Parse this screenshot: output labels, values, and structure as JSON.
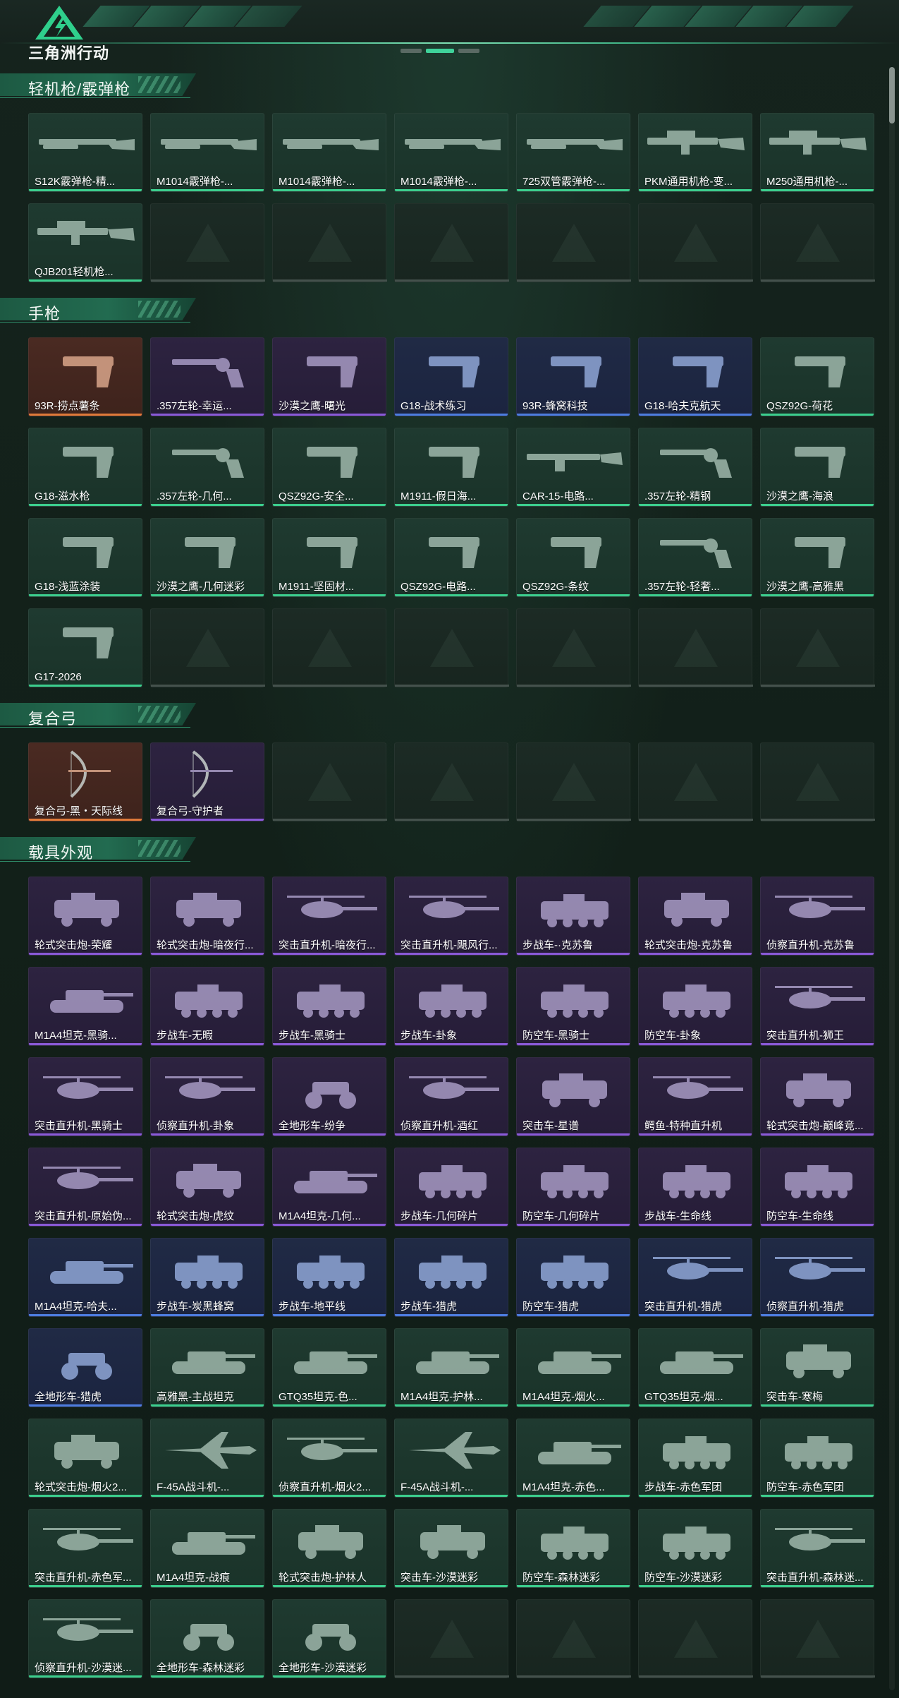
{
  "app": {
    "logo_text": "三角洲行动"
  },
  "colors": {
    "green": "#3ccf8e",
    "blue": "#4d7de0",
    "purple": "#8a5ad8",
    "orange": "#e07a3a",
    "background": "#13201b"
  },
  "sections": [
    {
      "title": "轻机枪/霰弹枪",
      "empty_slots": 6,
      "items": [
        {
          "name": "S12K霰弹枪-精...",
          "rarity": "green",
          "icon": "shotgun-icon"
        },
        {
          "name": "M1014霰弹枪-...",
          "rarity": "green",
          "icon": "shotgun-icon"
        },
        {
          "name": "M1014霰弹枪-...",
          "rarity": "green",
          "icon": "shotgun-icon"
        },
        {
          "name": "M1014霰弹枪-...",
          "rarity": "green",
          "icon": "shotgun-icon"
        },
        {
          "name": "725双管霰弹枪-...",
          "rarity": "green",
          "icon": "shotgun-icon"
        },
        {
          "name": "PKM通用机枪-变...",
          "rarity": "green",
          "icon": "machine-gun-icon"
        },
        {
          "name": "M250通用机枪-...",
          "rarity": "green",
          "icon": "machine-gun-icon"
        },
        {
          "name": "QJB201轻机枪...",
          "rarity": "green",
          "icon": "machine-gun-icon"
        }
      ]
    },
    {
      "title": "手枪",
      "empty_slots": 6,
      "items": [
        {
          "name": "93R-捞点薯条",
          "rarity": "orange",
          "icon": "pistol-icon"
        },
        {
          "name": ".357左轮-幸运...",
          "rarity": "purple",
          "icon": "revolver-icon"
        },
        {
          "name": "沙漠之鹰-曙光",
          "rarity": "purple",
          "icon": "pistol-icon"
        },
        {
          "name": "G18-战术练习",
          "rarity": "blue",
          "icon": "pistol-icon"
        },
        {
          "name": "93R-蜂窝科技",
          "rarity": "blue",
          "icon": "pistol-icon"
        },
        {
          "name": "G18-哈夫克航天",
          "rarity": "blue",
          "icon": "pistol-icon"
        },
        {
          "name": "QSZ92G-荷花",
          "rarity": "green",
          "icon": "pistol-icon"
        },
        {
          "name": "G18-滋水枪",
          "rarity": "green",
          "icon": "pistol-icon"
        },
        {
          "name": ".357左轮-几何...",
          "rarity": "green",
          "icon": "revolver-icon"
        },
        {
          "name": "QSZ92G-安全...",
          "rarity": "green",
          "icon": "pistol-icon"
        },
        {
          "name": "M1911-假日海...",
          "rarity": "green",
          "icon": "pistol-icon"
        },
        {
          "name": "CAR-15-电路...",
          "rarity": "green",
          "icon": "rifle-icon"
        },
        {
          "name": ".357左轮-精钢",
          "rarity": "green",
          "icon": "revolver-icon"
        },
        {
          "name": "沙漠之鹰-海浪",
          "rarity": "green",
          "icon": "pistol-icon"
        },
        {
          "name": "G18-浅蓝涂装",
          "rarity": "green",
          "icon": "pistol-icon"
        },
        {
          "name": "沙漠之鹰-几何迷彩",
          "rarity": "green",
          "icon": "pistol-icon"
        },
        {
          "name": "M1911-坚固材...",
          "rarity": "green",
          "icon": "pistol-icon"
        },
        {
          "name": "QSZ92G-电路...",
          "rarity": "green",
          "icon": "pistol-icon"
        },
        {
          "name": "QSZ92G-条纹",
          "rarity": "green",
          "icon": "pistol-icon"
        },
        {
          "name": ".357左轮-轻奢...",
          "rarity": "green",
          "icon": "revolver-icon"
        },
        {
          "name": "沙漠之鹰-高雅黑",
          "rarity": "green",
          "icon": "pistol-icon"
        },
        {
          "name": "G17-2026",
          "rarity": "green",
          "icon": "pistol-icon"
        }
      ]
    },
    {
      "title": "复合弓",
      "empty_slots": 5,
      "items": [
        {
          "name": "复合弓-黑・天际线",
          "rarity": "orange",
          "icon": "bow-icon"
        },
        {
          "name": "复合弓-守护者",
          "rarity": "purple",
          "icon": "bow-icon"
        }
      ]
    },
    {
      "title": "载具外观",
      "empty_slots": 4,
      "items": [
        {
          "name": "轮式突击炮-荣耀",
          "rarity": "purple",
          "icon": "armored-car-icon"
        },
        {
          "name": "轮式突击炮-暗夜行...",
          "rarity": "purple",
          "icon": "armored-car-icon"
        },
        {
          "name": "突击直升机-暗夜行...",
          "rarity": "purple",
          "icon": "helicopter-icon"
        },
        {
          "name": "突击直升机-飓风行...",
          "rarity": "purple",
          "icon": "helicopter-icon"
        },
        {
          "name": "步战车-·克苏鲁",
          "rarity": "purple",
          "icon": "ifv-icon"
        },
        {
          "name": "轮式突击炮-克苏鲁",
          "rarity": "purple",
          "icon": "armored-car-icon"
        },
        {
          "name": "侦察直升机-克苏鲁",
          "rarity": "purple",
          "icon": "helicopter-icon"
        },
        {
          "name": "M1A4坦克-黑骑...",
          "rarity": "purple",
          "icon": "tank-icon"
        },
        {
          "name": "步战车-无暇",
          "rarity": "purple",
          "icon": "ifv-icon"
        },
        {
          "name": "步战车-黑骑士",
          "rarity": "purple",
          "icon": "ifv-icon"
        },
        {
          "name": "步战车-卦象",
          "rarity": "purple",
          "icon": "ifv-icon"
        },
        {
          "name": "防空车-黑骑士",
          "rarity": "purple",
          "icon": "ifv-icon"
        },
        {
          "name": "防空车-卦象",
          "rarity": "purple",
          "icon": "ifv-icon"
        },
        {
          "name": "突击直升机-狮王",
          "rarity": "purple",
          "icon": "helicopter-icon"
        },
        {
          "name": "突击直升机-黑骑士",
          "rarity": "purple",
          "icon": "helicopter-icon"
        },
        {
          "name": "侦察直升机-卦象",
          "rarity": "purple",
          "icon": "helicopter-icon"
        },
        {
          "name": "全地形车-纷争",
          "rarity": "purple",
          "icon": "atv-icon"
        },
        {
          "name": "侦察直升机-酒红",
          "rarity": "purple",
          "icon": "helicopter-icon"
        },
        {
          "name": "突击车-星谱",
          "rarity": "purple",
          "icon": "armored-car-icon"
        },
        {
          "name": "鳄鱼-特种直升机",
          "rarity": "purple",
          "icon": "helicopter-icon"
        },
        {
          "name": "轮式突击炮-巅峰竞...",
          "rarity": "purple",
          "icon": "armored-car-icon"
        },
        {
          "name": "突击直升机-原始伪...",
          "rarity": "purple",
          "icon": "helicopter-icon"
        },
        {
          "name": "轮式突击炮-虎纹",
          "rarity": "purple",
          "icon": "armored-car-icon"
        },
        {
          "name": "M1A4坦克-几何...",
          "rarity": "purple",
          "icon": "tank-icon"
        },
        {
          "name": "步战车-几何碎片",
          "rarity": "purple",
          "icon": "ifv-icon"
        },
        {
          "name": "防空车-几何碎片",
          "rarity": "purple",
          "icon": "ifv-icon"
        },
        {
          "name": "步战车-生命线",
          "rarity": "purple",
          "icon": "ifv-icon"
        },
        {
          "name": "防空车-生命线",
          "rarity": "purple",
          "icon": "ifv-icon"
        },
        {
          "name": "M1A4坦克-哈夫...",
          "rarity": "blue",
          "icon": "tank-icon"
        },
        {
          "name": "步战车-炭黑蜂窝",
          "rarity": "blue",
          "icon": "ifv-icon"
        },
        {
          "name": "步战车-地平线",
          "rarity": "blue",
          "icon": "ifv-icon"
        },
        {
          "name": "步战车-猎虎",
          "rarity": "blue",
          "icon": "ifv-icon"
        },
        {
          "name": "防空车-猎虎",
          "rarity": "blue",
          "icon": "ifv-icon"
        },
        {
          "name": "突击直升机-猎虎",
          "rarity": "blue",
          "icon": "helicopter-icon"
        },
        {
          "name": "侦察直升机-猎虎",
          "rarity": "blue",
          "icon": "helicopter-icon"
        },
        {
          "name": "全地形车-猎虎",
          "rarity": "blue",
          "icon": "atv-icon"
        },
        {
          "name": "高雅黑-主战坦克",
          "rarity": "green",
          "icon": "tank-icon"
        },
        {
          "name": "GTQ35坦克-色...",
          "rarity": "green",
          "icon": "tank-icon"
        },
        {
          "name": "M1A4坦克-护林...",
          "rarity": "green",
          "icon": "tank-icon"
        },
        {
          "name": "M1A4坦克-烟火...",
          "rarity": "green",
          "icon": "tank-icon"
        },
        {
          "name": "GTQ35坦克-烟...",
          "rarity": "green",
          "icon": "tank-icon"
        },
        {
          "name": "突击车-寒梅",
          "rarity": "green",
          "icon": "armored-car-icon"
        },
        {
          "name": "轮式突击炮-烟火2...",
          "rarity": "green",
          "icon": "armored-car-icon"
        },
        {
          "name": "F-45A战斗机-...",
          "rarity": "green",
          "icon": "jet-icon"
        },
        {
          "name": "侦察直升机-烟火2...",
          "rarity": "green",
          "icon": "helicopter-icon"
        },
        {
          "name": "F-45A战斗机-...",
          "rarity": "green",
          "icon": "jet-icon"
        },
        {
          "name": "M1A4坦克-赤色...",
          "rarity": "green",
          "icon": "tank-icon"
        },
        {
          "name": "步战车-赤色军团",
          "rarity": "green",
          "icon": "ifv-icon"
        },
        {
          "name": "防空车-赤色军团",
          "rarity": "green",
          "icon": "ifv-icon"
        },
        {
          "name": "突击直升机-赤色军...",
          "rarity": "green",
          "icon": "helicopter-icon"
        },
        {
          "name": "M1A4坦克-战痕",
          "rarity": "green",
          "icon": "tank-icon"
        },
        {
          "name": "轮式突击炮-护林人",
          "rarity": "green",
          "icon": "armored-car-icon"
        },
        {
          "name": "突击车-沙漠迷彩",
          "rarity": "green",
          "icon": "armored-car-icon"
        },
        {
          "name": "防空车-森林迷彩",
          "rarity": "green",
          "icon": "ifv-icon"
        },
        {
          "name": "防空车-沙漠迷彩",
          "rarity": "green",
          "icon": "ifv-icon"
        },
        {
          "name": "突击直升机-森林迷...",
          "rarity": "green",
          "icon": "helicopter-icon"
        },
        {
          "name": "侦察直升机-沙漠迷...",
          "rarity": "green",
          "icon": "helicopter-icon"
        },
        {
          "name": "全地形车-森林迷彩",
          "rarity": "green",
          "icon": "atv-icon"
        },
        {
          "name": "全地形车-沙漠迷彩",
          "rarity": "green",
          "icon": "atv-icon"
        }
      ]
    }
  ]
}
